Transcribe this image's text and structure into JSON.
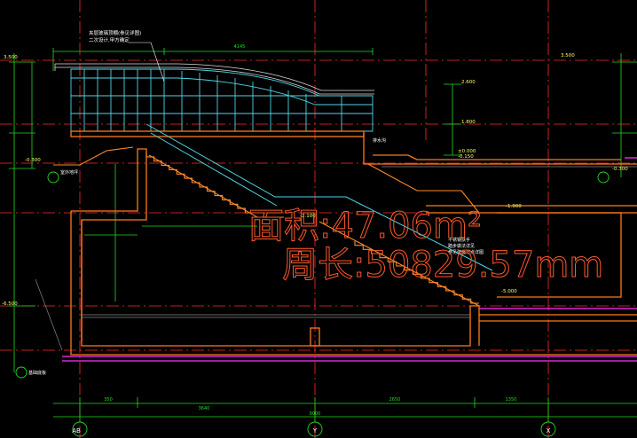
{
  "colors": {
    "background": "#000000",
    "grid_red": "#ff2a2a",
    "dim_green": "#22dd22",
    "glass_cyan": "#4fd6e6",
    "wall_orange": "#ff7a1a",
    "stair_orange": "#ff8a2a",
    "slab_magenta": "#ff33ff",
    "note_white": "#ffffff",
    "text_yellow": "#ffff66"
  },
  "overlay": {
    "area_text": "面积:47.06m²",
    "perimeter_text": "周长:50829.57mm"
  },
  "grid_axes": [
    {
      "id": "axis-left",
      "label": "AB"
    },
    {
      "id": "axis-middle",
      "label": "Y"
    },
    {
      "id": "axis-right",
      "label": "X"
    }
  ],
  "canopy_note": [
    "夹层玻璃顶棚(参见详图)",
    "二次设计,甲方确定"
  ],
  "elevations": {
    "roof_right": "2.600",
    "level_mid": "1.800",
    "level_low": "±0.000",
    "level_minus": "-0.150",
    "basement_right": "-1.900",
    "basement_mid": "-2.100",
    "floor_bottom": "-5.000",
    "left_top": "3.500",
    "right_top": "3.500",
    "left_low": "-0.300",
    "right_low": "-0.300",
    "left_bottom": "-6.500"
  },
  "dimensions": {
    "top_span": "4145",
    "bottom_total": "9000",
    "bottom_a": "3640",
    "bottom_b": "350",
    "bottom_c": "2650",
    "bottom_d": "1350"
  },
  "notes": {
    "railing_note": "不锈钢扶手",
    "stair_note": "踏步做法详见",
    "stair_note2": "参见建施节点详图",
    "drain_note": "排水沟",
    "left_ground": "室外地坪",
    "left_bottom_note": "基础底板"
  }
}
